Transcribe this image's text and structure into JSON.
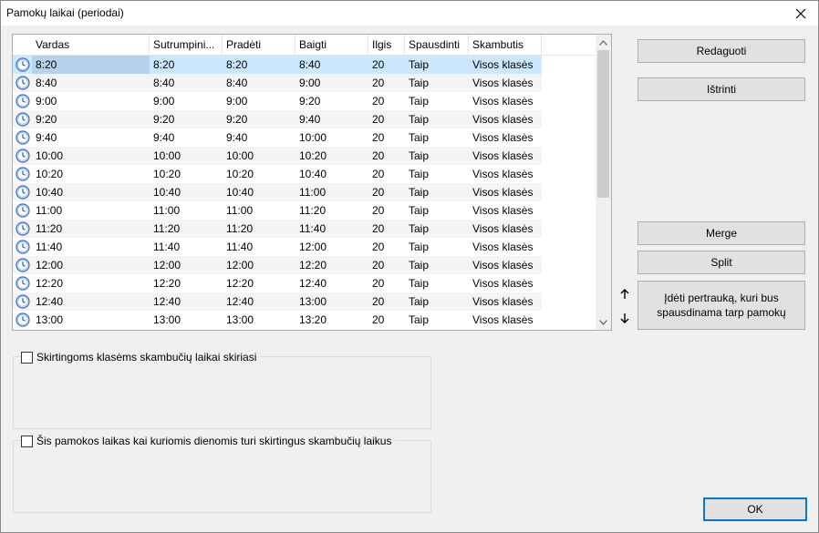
{
  "window": {
    "title": "Pamokų laikai (periodai)"
  },
  "list": {
    "columns": [
      "Vardas",
      "Sutrumpini...",
      "Pradėti",
      "Baigti",
      "Ilgis",
      "Spausdinti",
      "Skambutis"
    ],
    "rows": [
      [
        "8:20",
        "8:20",
        "8:20",
        "8:40",
        "20",
        "Taip",
        "Visos klasės"
      ],
      [
        "8:40",
        "8:40",
        "8:40",
        "9:00",
        "20",
        "Taip",
        "Visos klasės"
      ],
      [
        "9:00",
        "9:00",
        "9:00",
        "9:20",
        "20",
        "Taip",
        "Visos klasės"
      ],
      [
        "9:20",
        "9:20",
        "9:20",
        "9:40",
        "20",
        "Taip",
        "Visos klasės"
      ],
      [
        "9:40",
        "9:40",
        "9:40",
        "10:00",
        "20",
        "Taip",
        "Visos klasės"
      ],
      [
        "10:00",
        "10:00",
        "10:00",
        "10:20",
        "20",
        "Taip",
        "Visos klasės"
      ],
      [
        "10:20",
        "10:20",
        "10:20",
        "10:40",
        "20",
        "Taip",
        "Visos klasės"
      ],
      [
        "10:40",
        "10:40",
        "10:40",
        "11:00",
        "20",
        "Taip",
        "Visos klasės"
      ],
      [
        "11:00",
        "11:00",
        "11:00",
        "11:20",
        "20",
        "Taip",
        "Visos klasės"
      ],
      [
        "11:20",
        "11:20",
        "11:20",
        "11:40",
        "20",
        "Taip",
        "Visos klasės"
      ],
      [
        "11:40",
        "11:40",
        "11:40",
        "12:00",
        "20",
        "Taip",
        "Visos klasės"
      ],
      [
        "12:00",
        "12:00",
        "12:00",
        "12:20",
        "20",
        "Taip",
        "Visos klasės"
      ],
      [
        "12:20",
        "12:20",
        "12:20",
        "12:40",
        "20",
        "Taip",
        "Visos klasės"
      ],
      [
        "12:40",
        "12:40",
        "12:40",
        "13:00",
        "20",
        "Taip",
        "Visos klasės"
      ],
      [
        "13:00",
        "13:00",
        "13:00",
        "13:20",
        "20",
        "Taip",
        "Visos klasės"
      ]
    ],
    "selected_row": 0,
    "row_icon": "clock-icon"
  },
  "buttons": {
    "edit": "Redaguoti",
    "delete": "Ištrinti",
    "merge": "Merge",
    "split": "Split",
    "insert_break": "Įdėti pertrauką, kuri bus spausdinama tarp pamokų",
    "ok": "OK"
  },
  "options": {
    "different_per_class": "Skirtingoms klasėms skambučių laikai skiriasi",
    "different_per_day": "Šis pamokos laikas kai kuriomis dienomis turi skirtingus skambučių laikus"
  },
  "colors": {
    "selection": "#cce8ff",
    "default_button_border": "#0078d7",
    "icon_blue": "#2d6fc4"
  }
}
